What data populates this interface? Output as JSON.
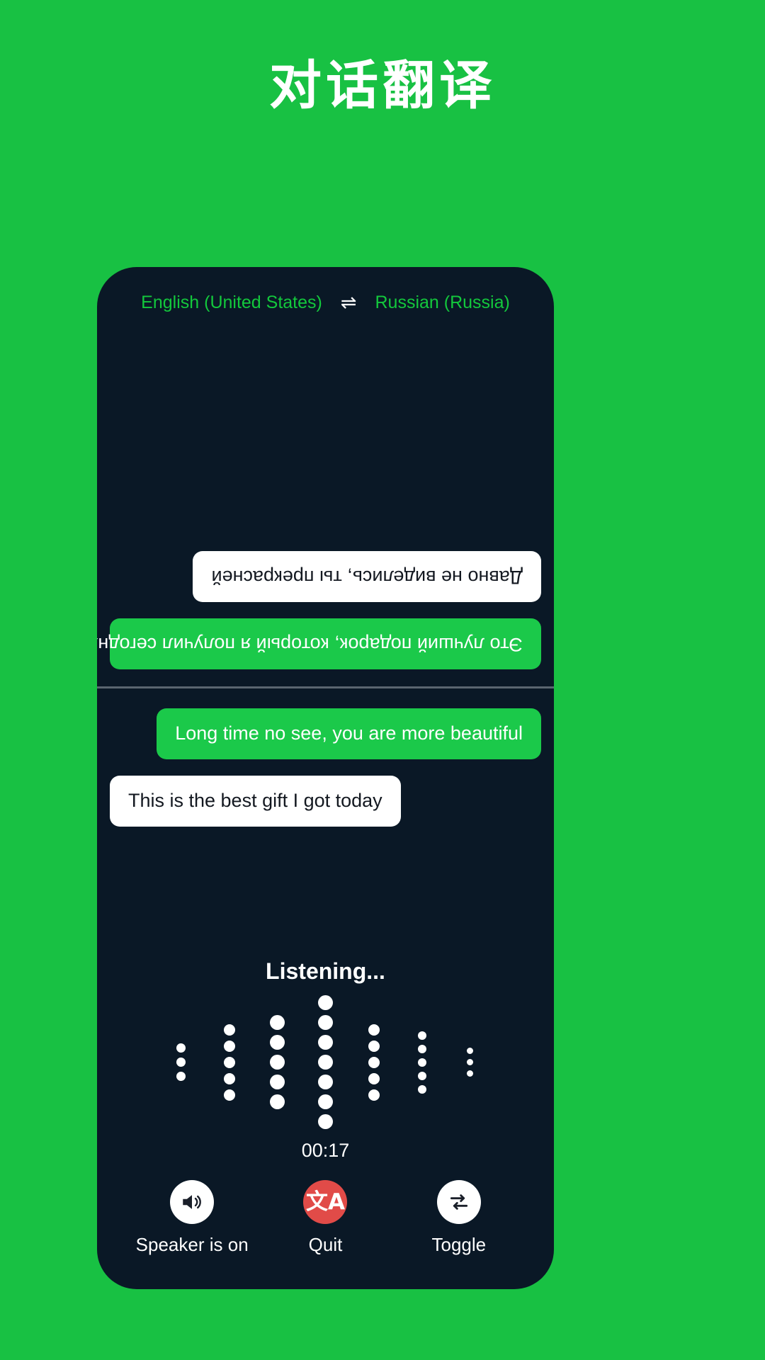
{
  "page": {
    "title": "对话翻译",
    "background_color": "#18c143"
  },
  "phone": {
    "background_color": "#0a1826",
    "language_bar": {
      "source_language": "English (United States)",
      "swap_icon": "swap-horizontal-icon",
      "swap_glyph": "⇌",
      "target_language": "Russian (Russia)",
      "text_color": "#13c83c"
    },
    "conversation_top": {
      "rotated": true,
      "messages": [
        {
          "text": "Это лучший подарок, который я получил сегодня",
          "style": "green",
          "align": "align-right"
        },
        {
          "text": "Давно не виделись, ты прекрасней",
          "style": "white",
          "align": "align-left"
        }
      ]
    },
    "conversation_bottom": {
      "messages": [
        {
          "text": "Long time no see, you are more beautiful",
          "style": "green",
          "align": "align-right"
        },
        {
          "text": "This is the best gift I got today",
          "style": "white",
          "align": "align-left"
        }
      ]
    },
    "mic_area": {
      "status_label": "Listening...",
      "timer": "00:17",
      "waveform_icon": "voice-waveform-icon",
      "waveform": [
        {
          "count": 3,
          "size": 13
        },
        {
          "count": 5,
          "size": 16
        },
        {
          "count": 5,
          "size": 21
        },
        {
          "count": 7,
          "size": 21
        },
        {
          "count": 5,
          "size": 16
        },
        {
          "count": 5,
          "size": 12
        },
        {
          "count": 3,
          "size": 9
        }
      ]
    },
    "controls": [
      {
        "label": "Speaker is on",
        "icon": "speaker-on-icon",
        "circle_style": "white",
        "circle_color": "#ffffff"
      },
      {
        "label": "Quit",
        "icon": "translate-icon",
        "glyph": "文A",
        "circle_style": "red",
        "circle_color": "#e14b48"
      },
      {
        "label": "Toggle",
        "icon": "swap-arrows-icon",
        "circle_style": "white",
        "circle_color": "#ffffff"
      }
    ]
  }
}
